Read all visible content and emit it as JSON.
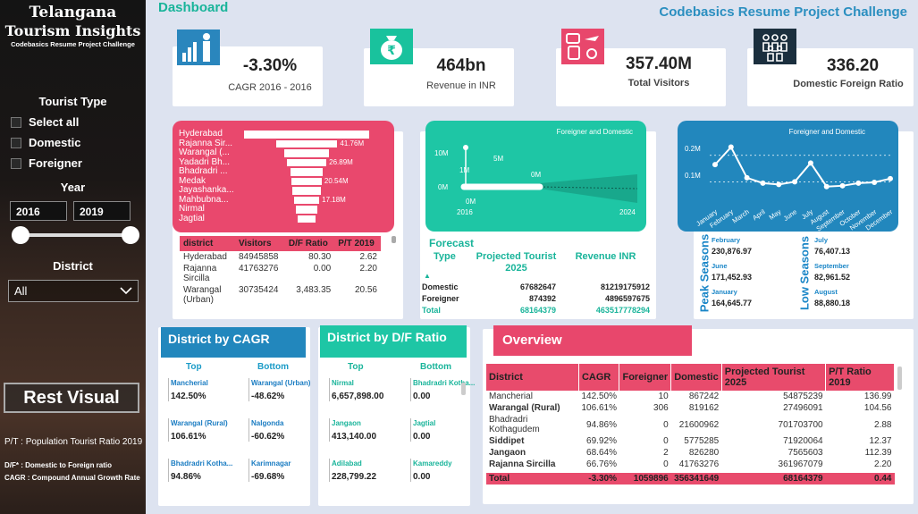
{
  "sidebar": {
    "title1": "Telangana",
    "title2": "Tourism Insights",
    "subtitle": "Codebasics Resume Project Challenge",
    "tourist_type_label": "Tourist Type",
    "options": [
      "Select all",
      "Domestic",
      "Foreigner"
    ],
    "year_label": "Year",
    "year_from": "2016",
    "year_to": "2019",
    "district_label": "District",
    "district_value": "All",
    "reset_label": "Rest Visual",
    "legend": [
      "P/T : Population Tourist Ratio 2019",
      "D/F* : Domestic to Foreign ratio",
      "CAGR : Compound Annual Growth Rate"
    ]
  },
  "header": {
    "dashboard": "Dashboard",
    "challenge": "Codebasics Resume Project Challenge"
  },
  "kpis": [
    {
      "value": "-3.30%",
      "label": "CAGR 2016 - 2016"
    },
    {
      "value": "464bn",
      "label": "Revenue in INR"
    },
    {
      "value": "357.40M",
      "label": "Total Visitors"
    },
    {
      "value": "336.20",
      "label": "Domestic Foreign Ratio"
    }
  ],
  "funnel": {
    "districts": [
      "Hyderabad",
      "Rajanna Sir...",
      "Warangal (...",
      "Yadadri Bh...",
      "Bhadradri ...",
      "Medak",
      "Jayashanka...",
      "Mahbubna...",
      "Nirmal",
      "Jagtial"
    ],
    "labels": [
      "",
      "41.76M",
      "",
      "26.89M",
      "",
      "20.54M",
      "",
      "17.18M",
      "",
      ""
    ],
    "values": [
      84.9,
      41.76,
      30.7,
      26.89,
      21.6,
      20.54,
      19.0,
      17.18,
      14.0,
      12.0
    ]
  },
  "district_table": {
    "headers": [
      "district",
      "Visitors",
      "D/F Ratio",
      "P/T 2019"
    ],
    "rows": [
      [
        "Hyderabad",
        "84945858",
        "80.30",
        "2.62"
      ],
      [
        "Rajanna Sircilla",
        "41763276",
        "0.00",
        "2.20"
      ],
      [
        "Warangal (Urban)",
        "30735424",
        "3,483.35",
        "20.56"
      ]
    ]
  },
  "forecast_chart": {
    "title": "Foreigner and Domestic",
    "y_ticks": [
      "10M",
      "0M"
    ],
    "labels": [
      "1M",
      "5M",
      "0M",
      "0M"
    ],
    "x_ticks": [
      "2016",
      "2024"
    ]
  },
  "forecast": {
    "title": "Forecast",
    "headers": [
      "Type",
      "Projected Tourist 2025",
      "Revenue INR"
    ],
    "rows": [
      [
        "Domestic",
        "67682647",
        "81219175912"
      ],
      [
        "Foreigner",
        "874392",
        "4896597675"
      ]
    ],
    "total": [
      "Total",
      "68164379",
      "463517778294"
    ]
  },
  "season_chart": {
    "title": "Foreigner and Domestic",
    "y_ticks": [
      "0.2M",
      "0.1M"
    ],
    "months": [
      "January",
      "February",
      "March",
      "April",
      "May",
      "June",
      "July",
      "August",
      "September",
      "October",
      "November",
      "December"
    ]
  },
  "chart_data": {
    "type": "line",
    "title": "Foreigner and Domestic",
    "categories": [
      "January",
      "February",
      "March",
      "April",
      "May",
      "June",
      "July",
      "August",
      "September",
      "October",
      "November",
      "December"
    ],
    "series": [
      {
        "values": [
          0.165,
          0.231,
          0.115,
          0.095,
          0.09,
          0.1,
          0.171,
          0.082,
          0.085,
          0.095,
          0.098,
          0.112
        ]
      }
    ],
    "ylim": [
      0,
      0.27
    ]
  },
  "seasons": {
    "peak_label": "Peak Seasons",
    "low_label": "Low Seasons",
    "peak": [
      {
        "month": "February",
        "value": "230,876.97"
      },
      {
        "month": "June",
        "value": "171,452.93"
      },
      {
        "month": "January",
        "value": "164,645.77"
      }
    ],
    "low": [
      {
        "month": "July",
        "value": "76,407.13"
      },
      {
        "month": "September",
        "value": "82,961.52"
      },
      {
        "month": "August",
        "value": "88,880.18"
      }
    ]
  },
  "cagr_panel": {
    "title": "District by CAGR",
    "top_label": "Top",
    "bottom_label": "Bottom",
    "top": [
      {
        "name": "Mancherial",
        "value": "142.50%"
      },
      {
        "name": "Warangal (Rural)",
        "value": "106.61%"
      },
      {
        "name": "Bhadradri Kotha...",
        "value": "94.86%"
      }
    ],
    "bottom": [
      {
        "name": "Warangal (Urban)",
        "value": "-48.62%"
      },
      {
        "name": "Nalgonda",
        "value": "-60.62%"
      },
      {
        "name": "Karimnagar",
        "value": "-69.68%"
      }
    ]
  },
  "df_panel": {
    "title": "District by D/F Ratio",
    "top_label": "Top",
    "bottom_label": "Bottom",
    "top": [
      {
        "name": "Nirmal",
        "value": "6,657,898.00"
      },
      {
        "name": "Jangaon",
        "value": "413,140.00"
      },
      {
        "name": "Adilabad",
        "value": "228,799.22"
      }
    ],
    "bottom": [
      {
        "name": "Bhadradri Kotha...",
        "value": "0.00"
      },
      {
        "name": "Jagtial",
        "value": "0.00"
      },
      {
        "name": "Kamareddy",
        "value": "0.00"
      }
    ]
  },
  "overview": {
    "title": "Overview",
    "headers": [
      "District",
      "CAGR",
      "Foreigner",
      "Domestic",
      "Projected Tourist 2025",
      "P/T Ratio 2019"
    ],
    "rows": [
      [
        "Mancherial",
        "142.50%",
        "10",
        "867242",
        "54875239",
        "136.99"
      ],
      [
        "Warangal (Rural)",
        "106.61%",
        "306",
        "819162",
        "27496091",
        "104.56"
      ],
      [
        "Bhadradri Kothagudem",
        "94.86%",
        "0",
        "21600962",
        "701703700",
        "2.88"
      ],
      [
        "Siddipet",
        "69.92%",
        "0",
        "5775285",
        "71920064",
        "12.37"
      ],
      [
        "Jangaon",
        "68.64%",
        "2",
        "826280",
        "7565603",
        "112.39"
      ],
      [
        "Rajanna Sircilla",
        "66.76%",
        "0",
        "41763276",
        "361967079",
        "2.20"
      ]
    ],
    "total": [
      "Total",
      "-3.30%",
      "1059896",
      "356341649",
      "68164379",
      "0.44"
    ]
  }
}
